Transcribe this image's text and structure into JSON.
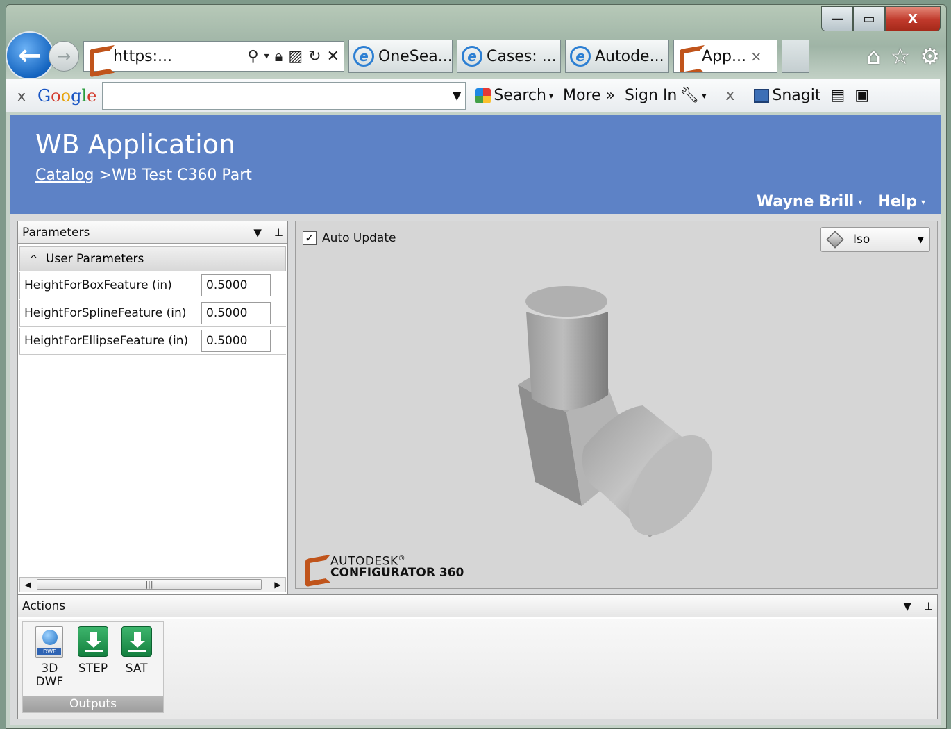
{
  "browser": {
    "address_text": "https:...",
    "tabs": [
      {
        "label": "OneSea...",
        "icon": "ie-icon"
      },
      {
        "label": "Cases: ...",
        "icon": "ie-icon"
      },
      {
        "label": "Autode...",
        "icon": "ie-icon"
      },
      {
        "label": "App...",
        "icon": "configurator-icon",
        "close": "×"
      }
    ],
    "window_controls": {
      "minimize": "—",
      "maximize": "▭",
      "close": "X"
    }
  },
  "google_toolbar": {
    "close": "x",
    "logo": [
      "G",
      "o",
      "o",
      "g",
      "l",
      "e"
    ],
    "search_label": "Search",
    "more_label": "More »",
    "signin_label": "Sign In",
    "close2": "x",
    "snagit_label": "Snagit"
  },
  "app": {
    "title": "WB Application",
    "breadcrumb_link": "Catalog",
    "breadcrumb_current": ">WB Test C360 Part",
    "user": "Wayne Brill",
    "help": "Help",
    "header_color": "#5d82c6"
  },
  "parameters": {
    "title": "Parameters",
    "group": "User Parameters",
    "rows": [
      {
        "name": "HeightForBoxFeature (in)",
        "value": "0.5000"
      },
      {
        "name": "HeightForSplineFeature (in)",
        "value": "0.5000"
      },
      {
        "name": "HeightForEllipseFeature (in)",
        "value": "0.5000"
      }
    ]
  },
  "viewer": {
    "auto_update_label": "Auto Update",
    "auto_update_checked": true,
    "view_mode": "Iso",
    "brand_line1": "AUTODESK",
    "brand_line1_mark": "®",
    "brand_line2": "CONFIGURATOR 360"
  },
  "actions": {
    "title": "Actions",
    "group_label": "Outputs",
    "buttons": [
      {
        "line1": "3D",
        "line2": "DWF",
        "icon": "dwf-file-icon",
        "badge": "DWF"
      },
      {
        "line1": "STEP",
        "line2": "",
        "icon": "download-icon"
      },
      {
        "line1": "SAT",
        "line2": "",
        "icon": "download-icon"
      }
    ]
  }
}
